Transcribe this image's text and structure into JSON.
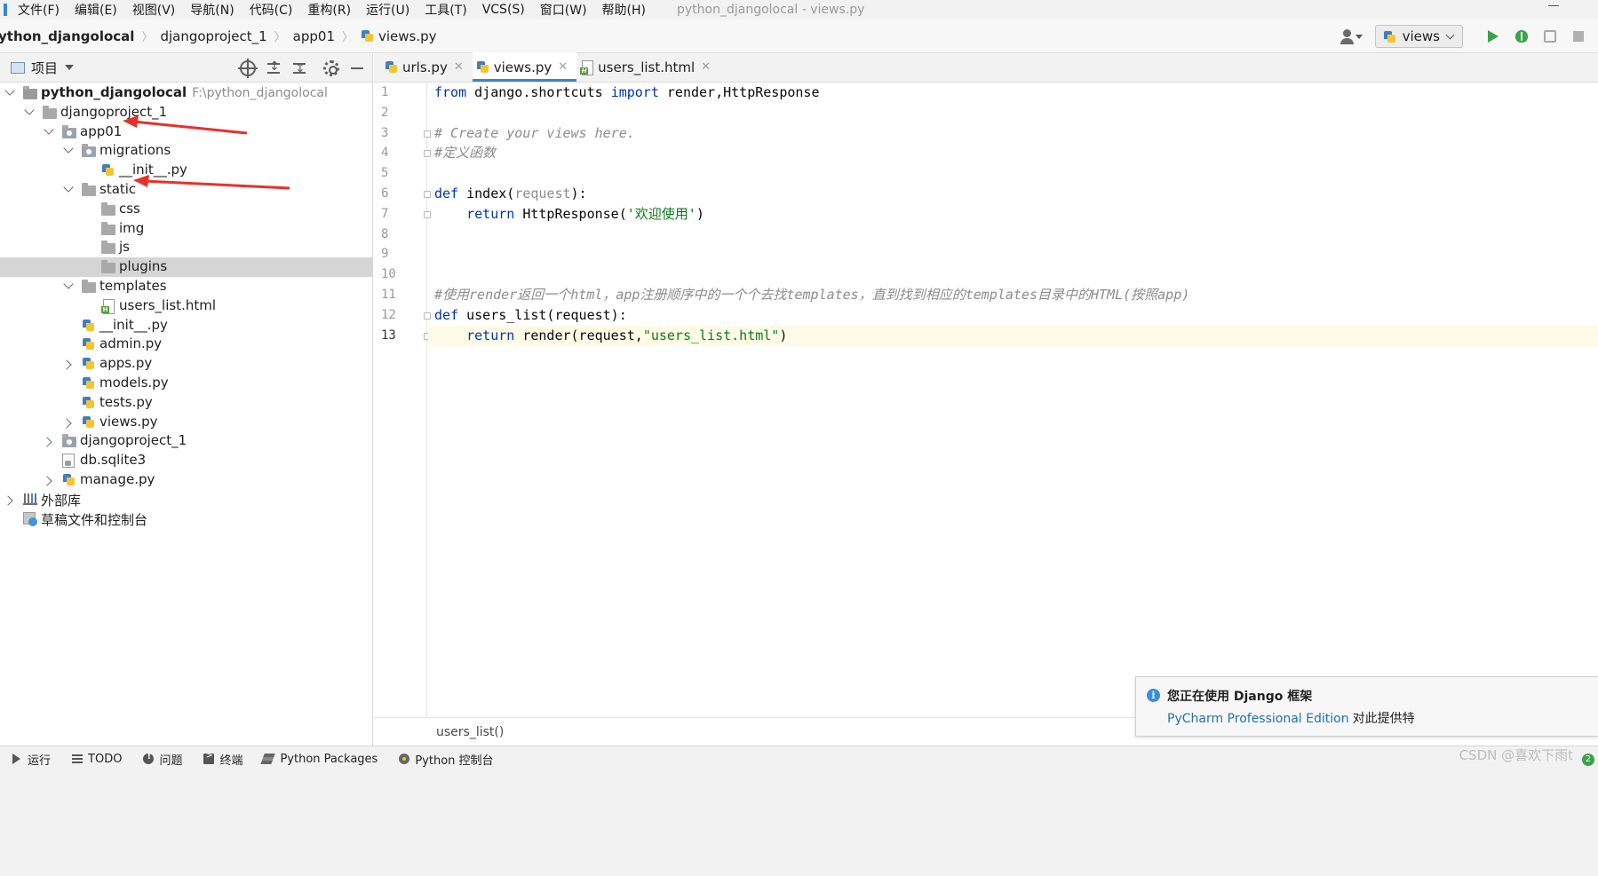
{
  "menubar": {
    "items": [
      "文件(F)",
      "编辑(E)",
      "视图(V)",
      "导航(N)",
      "代码(C)",
      "重构(R)",
      "运行(U)",
      "工具(T)",
      "VCS(S)",
      "窗口(W)",
      "帮助(H)"
    ],
    "window_title": "python_djangolocal - views.py"
  },
  "navbar": {
    "breadcrumb": [
      "ython_djangolocal",
      "djangoproject_1",
      "app01",
      "views.py"
    ],
    "run_config": "views",
    "accent_run": "#3aa24a"
  },
  "project": {
    "title": "项目",
    "tree": [
      {
        "label": "python_djangolocal",
        "path": "F:\\python_djangolocal",
        "icon": "root-folder-icon",
        "arrow": "open",
        "bold": true
      },
      {
        "label": "djangoproject_1",
        "icon": "folder-icon",
        "arrow": "open"
      },
      {
        "label": "app01",
        "icon": "module-folder-icon",
        "arrow": "open"
      },
      {
        "label": "migrations",
        "icon": "module-folder-icon",
        "arrow": "open"
      },
      {
        "label": "__init__.py",
        "icon": "python-file-icon",
        "arrow": ""
      },
      {
        "label": "static",
        "icon": "folder-icon",
        "arrow": "open"
      },
      {
        "label": "css",
        "icon": "folder-icon",
        "arrow": ""
      },
      {
        "label": "img",
        "icon": "folder-icon",
        "arrow": ""
      },
      {
        "label": "js",
        "icon": "folder-icon",
        "arrow": ""
      },
      {
        "label": "plugins",
        "icon": "folder-icon",
        "arrow": "",
        "selected": true
      },
      {
        "label": "templates",
        "icon": "folder-icon",
        "arrow": "open"
      },
      {
        "label": "users_list.html",
        "icon": "html-file-icon",
        "arrow": ""
      },
      {
        "label": "__init__.py",
        "icon": "python-file-icon",
        "arrow": ""
      },
      {
        "label": "admin.py",
        "icon": "python-file-icon",
        "arrow": ""
      },
      {
        "label": "apps.py",
        "icon": "python-file-icon",
        "arrow": "closed"
      },
      {
        "label": "models.py",
        "icon": "python-file-icon",
        "arrow": ""
      },
      {
        "label": "tests.py",
        "icon": "python-file-icon",
        "arrow": ""
      },
      {
        "label": "views.py",
        "icon": "python-file-icon",
        "arrow": "closed"
      },
      {
        "label": "djangoproject_1",
        "icon": "module-folder-icon",
        "arrow": "closed"
      },
      {
        "label": "db.sqlite3",
        "icon": "database-file-icon",
        "arrow": ""
      },
      {
        "label": "manage.py",
        "icon": "python-file-icon",
        "arrow": "closed"
      },
      {
        "label": "外部库",
        "icon": "library-icon",
        "arrow": "closed"
      },
      {
        "label": "草稿文件和控制台",
        "icon": "scratch-icon",
        "arrow": ""
      }
    ]
  },
  "editor": {
    "tabs": [
      {
        "label": "urls.py",
        "icon": "python-file-icon",
        "active": false
      },
      {
        "label": "views.py",
        "icon": "python-file-icon",
        "active": true
      },
      {
        "label": "users_list.html",
        "icon": "html-file-icon",
        "active": false
      }
    ],
    "lines": [
      [
        {
          "t": "from",
          "c": "kw"
        },
        {
          "t": " django.shortcuts "
        },
        {
          "t": "import",
          "c": "kw"
        },
        {
          "t": " render,HttpResponse"
        }
      ],
      [],
      [
        {
          "t": "# Create your views here.",
          "c": "cm"
        }
      ],
      [
        {
          "t": "#定义函数",
          "c": "cm"
        }
      ],
      [],
      [
        {
          "t": "def",
          "c": "kw"
        },
        {
          "t": " index("
        },
        {
          "t": "request",
          "c": "unused"
        },
        {
          "t": "):"
        }
      ],
      [
        {
          "t": "    "
        },
        {
          "t": "return",
          "c": "kw"
        },
        {
          "t": " HttpResponse("
        },
        {
          "t": "'欢迎使用'",
          "c": "str"
        },
        {
          "t": ")"
        }
      ],
      [],
      [],
      [],
      [
        {
          "t": "#使用render返回一个html，app注册顺序中的一个个去找templates，直到找到相应的templates目录中的HTML(按照app)",
          "c": "cm"
        }
      ],
      [
        {
          "t": "def",
          "c": "kw"
        },
        {
          "t": " users_list(request):"
        }
      ],
      [
        {
          "t": "    "
        },
        {
          "t": "return",
          "c": "kw"
        },
        {
          "t": " render(request,"
        },
        {
          "t": "\"users_list.html\"",
          "c": "str"
        },
        {
          "t": ")"
        }
      ]
    ],
    "current_line": 13,
    "status_context": "users_list()"
  },
  "notification": {
    "title": "您正在使用 Django 框架",
    "link": "PyCharm Professional Edition",
    "body": "对此提供特"
  },
  "bottombar": {
    "tabs": [
      {
        "label": "运行",
        "icon": "run-icon"
      },
      {
        "label": "TODO",
        "icon": "todo-icon"
      },
      {
        "label": "问题",
        "icon": "problems-icon"
      },
      {
        "label": "终端",
        "icon": "terminal-icon"
      },
      {
        "label": "Python Packages",
        "icon": "packages-icon"
      },
      {
        "label": "Python 控制台",
        "icon": "python-console-icon"
      }
    ],
    "watermark": "CSDN @喜欢下雨t",
    "event_count": "2"
  },
  "annotation_color": "#e8302a"
}
